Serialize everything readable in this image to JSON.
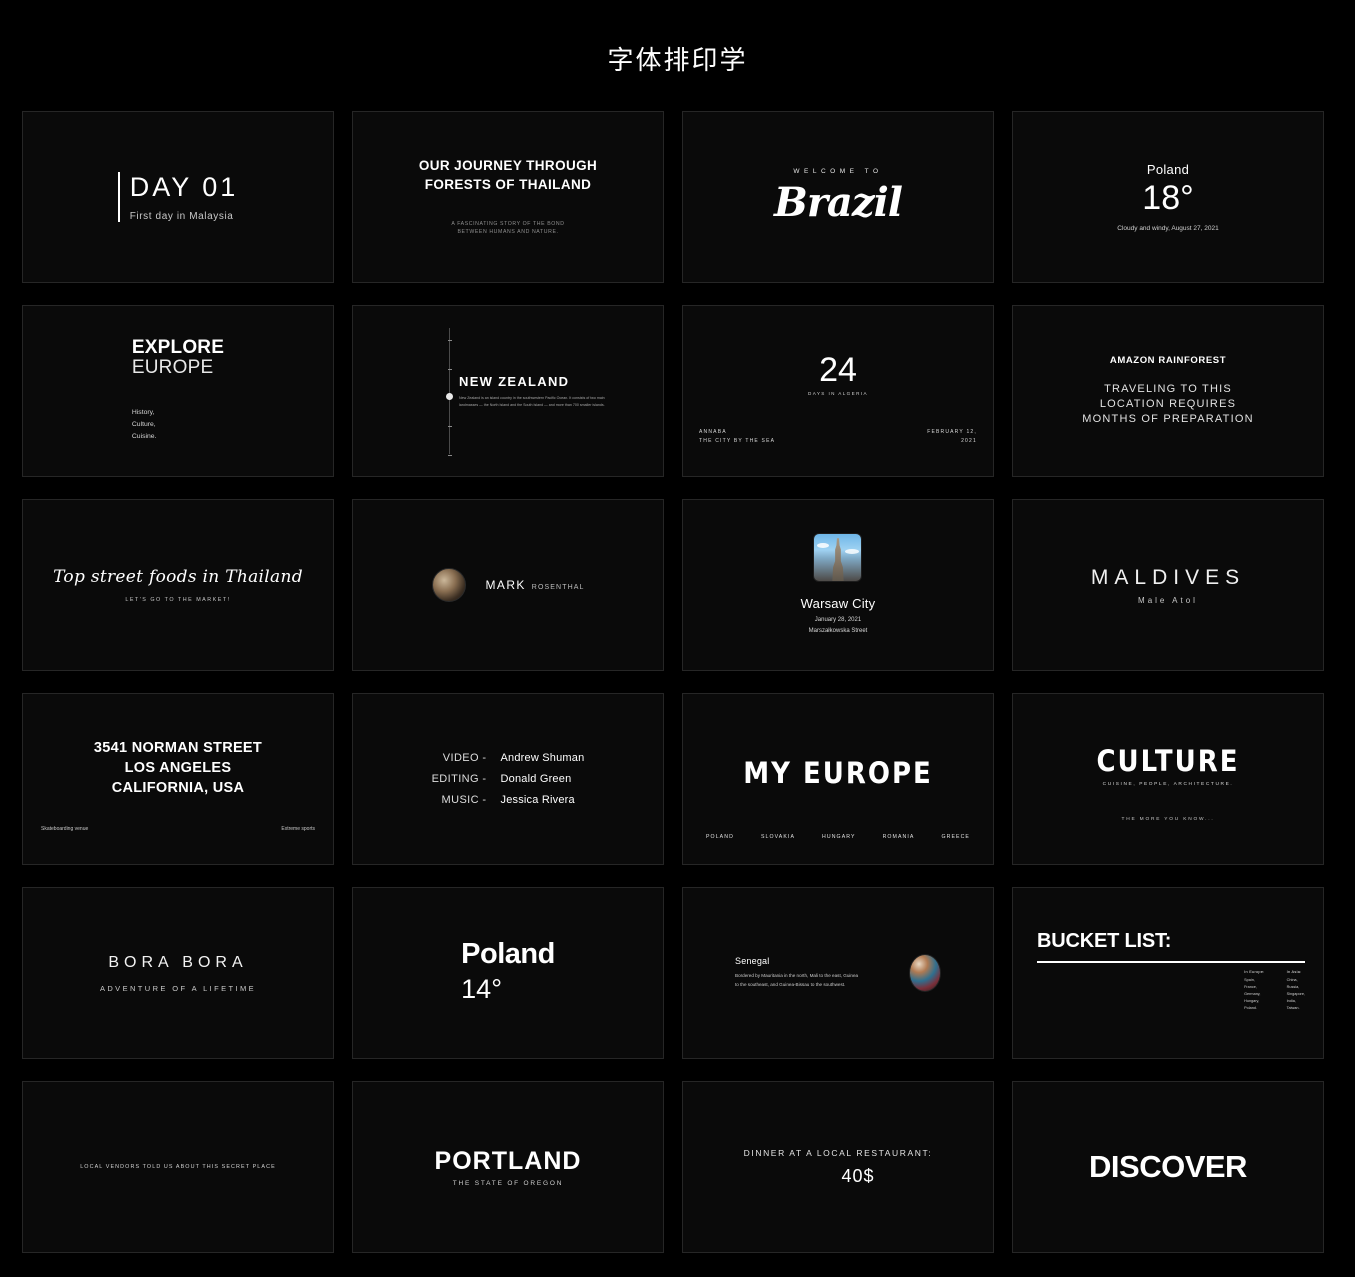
{
  "page": {
    "title": "字体排印学"
  },
  "cards": [
    {
      "id": "day-01",
      "title": "DAY 01",
      "subtitle": "First day in Malaysia"
    },
    {
      "id": "our-journey",
      "line1": "OUR JOURNEY THROUGH",
      "line2": "FORESTS OF THAILAND",
      "sub1": "A FASCINATING STORY OF THE BOND",
      "sub2": "BETWEEN HUMANS AND NATURE."
    },
    {
      "id": "brazil",
      "kicker": "WELCOME TO",
      "script": "Brazil"
    },
    {
      "id": "poland-18",
      "place": "Poland",
      "temp": "18°",
      "note": "Cloudy and windy, August 27, 2021"
    },
    {
      "id": "explore-europe",
      "bold": "EXPLORE",
      "thin": "EUROPE",
      "items": [
        "History,",
        "Culture,",
        "Cuisine."
      ]
    },
    {
      "id": "new-zealand",
      "title": "NEW ZEALAND",
      "body": "New Zealand is an island country in the southwestern Pacific Ocean. It consists of two main landmasses — the North Island and the South Island — and more than 700 smaller islands."
    },
    {
      "id": "24-days-algeria",
      "number": "24",
      "caption": "DAYS IN ALGERIA",
      "bottom_left_1": "ANNABA",
      "bottom_left_2": "THE CITY BY THE SEA",
      "bottom_right_1": "FEBRUARY 12,",
      "bottom_right_2": "2021"
    },
    {
      "id": "amazon-rainforest",
      "title": "AMAZON RAINFOREST",
      "line1": "TRAVELING TO THIS",
      "line2": "LOCATION REQUIRES",
      "line3": "MONTHS OF PREPARATION"
    },
    {
      "id": "street-foods",
      "script": "Top street foods in Thailand",
      "sub": "LET'S GO TO THE MARKET!"
    },
    {
      "id": "mark-rosenthal",
      "first": "MARK",
      "last": "ROSENTHAL",
      "avatar": "portrait-photo"
    },
    {
      "id": "warsaw-city",
      "photo": "palace-of-culture-photo",
      "title": "Warsaw City",
      "date": "January 28, 2021",
      "street": "Marszałkowska Street"
    },
    {
      "id": "maldives",
      "title": "MALDIVES",
      "sub": "Male Atol"
    },
    {
      "id": "norman-street",
      "line1": "3541 NORMAN STREET",
      "line2": "LOS ANGELES",
      "line3": "CALIFORNIA, USA",
      "bottom_left": "Skateboarding venue",
      "bottom_right": "Extreme sports"
    },
    {
      "id": "credits",
      "rows": [
        {
          "role": "VIDEO -",
          "name": "Andrew Shuman"
        },
        {
          "role": "EDITING -",
          "name": "Donald Green"
        },
        {
          "role": "MUSIC -",
          "name": "Jessica Rivera"
        }
      ]
    },
    {
      "id": "my-europe",
      "title": "MY EUROPE",
      "countries": [
        "POLAND",
        "SLOVAKIA",
        "HUNGARY",
        "ROMANIA",
        "GREECE"
      ]
    },
    {
      "id": "culture",
      "title": "CULTURE",
      "sub": "CUISINE, PEOPLE, ARCHITECTURE.",
      "footer": "THE MORE YOU KNOW..."
    },
    {
      "id": "bora-bora",
      "title": "BORA BORA",
      "sub": "ADVENTURE OF A LIFETIME"
    },
    {
      "id": "poland-14",
      "place": "Poland",
      "temp": "14°"
    },
    {
      "id": "senegal",
      "title": "Senegal",
      "body": "Bordered by Mauritania in the north, Mali to the east, Guinea to the southeast, and Guinea-Bissau to the southwest.",
      "photo": "crowd-photo"
    },
    {
      "id": "bucket-list",
      "title": "BUCKET LIST:",
      "col1_head": "In Europe:",
      "col1_items": [
        "Spain,",
        "France,",
        "Germany,",
        "Hungary,",
        "Poland."
      ],
      "col2_head": "In Asia:",
      "col2_items": [
        "China,",
        "Russia,",
        "Singapore,",
        "India,",
        "Taiwan."
      ]
    },
    {
      "id": "local-vendors",
      "text": "LOCAL VENDORS TOLD US ABOUT THIS SECRET PLACE"
    },
    {
      "id": "portland",
      "title": "PORTLAND",
      "sub": "THE STATE OF OREGON"
    },
    {
      "id": "dinner",
      "title": "DINNER AT A LOCAL RESTAURANT:",
      "price": "40$"
    },
    {
      "id": "discover",
      "title": "DISCOVER"
    }
  ]
}
